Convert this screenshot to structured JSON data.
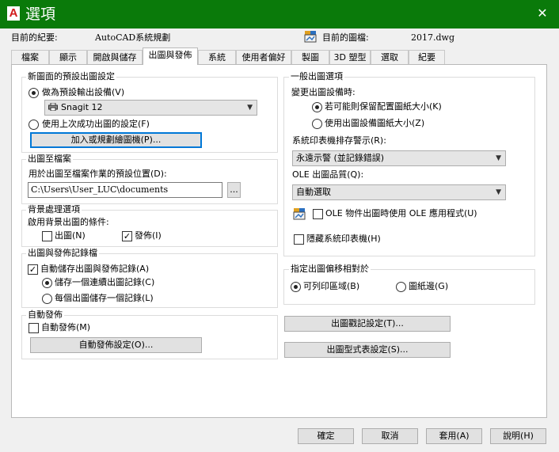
{
  "window": {
    "title": "選項",
    "app_icon_letter": "A",
    "close_glyph": "✕",
    "title_bar_color": "#0a7a0a"
  },
  "info": {
    "profile_label": "目前的紀要:",
    "profile_value": "AutoCAD系統規劃",
    "drawing_label": "目前的圖檔:",
    "drawing_value": "2017.dwg"
  },
  "tabs": [
    {
      "label": "檔案"
    },
    {
      "label": "顯示"
    },
    {
      "label": "開啟與儲存"
    },
    {
      "label": "出圖與發佈",
      "active": true
    },
    {
      "label": "系統"
    },
    {
      "label": "使用者偏好"
    },
    {
      "label": "製圖"
    },
    {
      "label": "3D 塑型"
    },
    {
      "label": "選取"
    },
    {
      "label": "紀要"
    }
  ],
  "default_output": {
    "legend": "新圖面的預設出圖設定",
    "use_as_default_label": "做為預設輸出設備(V)",
    "device_value": "Snagit 12",
    "use_last_label": "使用上次成功出圖的設定(F)",
    "add_plotters_button": "加入或規劃繪圖機(P)..."
  },
  "plot_to_file": {
    "legend": "出圖至檔案",
    "location_label": "用於出圖至檔案作業的預設位置(D):",
    "location_value": "C:\\Users\\User_LUC\\documents",
    "browse_button": "..."
  },
  "background": {
    "legend": "背景處理選項",
    "enable_label": "啟用背景出圖的條件:",
    "plotting_label": "出圖(N)",
    "publishing_label": "發佈(I)",
    "plotting_checked": false,
    "publishing_checked": true
  },
  "plot_log": {
    "legend": "出圖與發佈記錄檔",
    "auto_save_label": "自動儲存出圖與發佈記錄(A)",
    "continuous_label": "儲存一個連續出圖記錄(C)",
    "per_plot_label": "每個出圖儲存一個記錄(L)"
  },
  "auto_publish": {
    "legend": "自動發佈",
    "auto_publish_label": "自動發佈(M)",
    "settings_button": "自動發佈設定(O)..."
  },
  "general": {
    "legend": "一般出圖選項",
    "when_changing_label": "變更出圖設備時:",
    "keep_layout_label": "若可能則保留配置圖紙大小(K)",
    "use_device_label": "使用出圖設備圖紙大小(Z)",
    "spool_alert_label": "系統印表機排存警示(R):",
    "spool_alert_value": "永遠示警 (並記錄錯誤)",
    "ole_quality_label": "OLE 出圖品質(Q):",
    "ole_quality_value": "自動選取",
    "ole_app_label": "OLE 物件出圖時使用 OLE 應用程式(U)",
    "hide_printers_label": "隱藏系統印表機(H)"
  },
  "offset": {
    "legend": "指定出圖偏移相對於",
    "printable_label": "可列印區域(B)",
    "edge_label": "圖紙邊(G)"
  },
  "right_buttons": {
    "stamp": "出圖戳記設定(T)...",
    "style_table": "出圖型式表設定(S)..."
  },
  "footer": {
    "ok": "確定",
    "cancel": "取消",
    "apply": "套用(A)",
    "help": "說明(H)"
  }
}
